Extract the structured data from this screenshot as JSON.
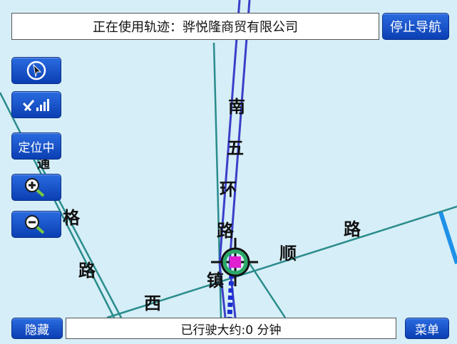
{
  "header": {
    "track_text": "正在使用轨迹：骅悦隆商贸有限公司",
    "stop_nav_label": "停止导航"
  },
  "sidebar": {
    "locating_label": "定位中"
  },
  "map": {
    "labels": {
      "nan": "南",
      "wu": "五",
      "huan": "环",
      "lu1": "路",
      "lu2": "路",
      "lu3": "路",
      "shun": "顺",
      "xi": "西",
      "tong": "通",
      "ge": "格",
      "zhen": "镇"
    }
  },
  "footer": {
    "hide_label": "隐藏",
    "status_text": "已行驶大约:0 分钟",
    "menu_label": "菜单"
  },
  "colors": {
    "map_bg": "#d6eef7",
    "button_blue": "#1a55cc",
    "road_blue": "#3b3fc9",
    "road_teal": "#2a8c8c",
    "water_blue": "#1e90e8",
    "marker_green": "#2aa868",
    "marker_magenta": "#e020d0"
  }
}
